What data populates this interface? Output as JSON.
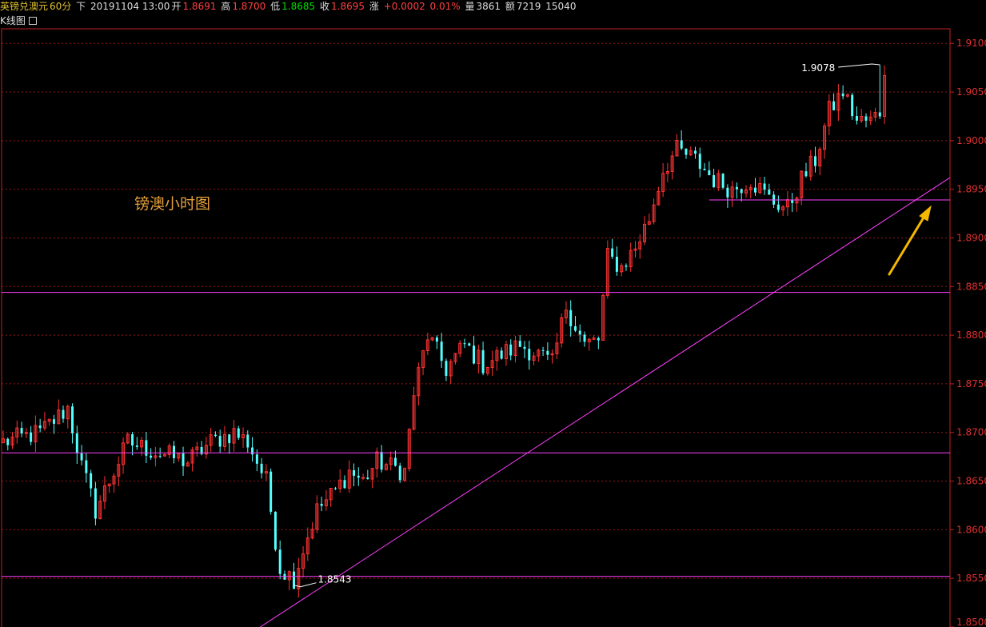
{
  "header": {
    "symbol": "英镑兑澳元",
    "period": "60分",
    "sub_label": "下",
    "datetime": "20191104 13:00",
    "open_label": "开",
    "open": "1.8691",
    "high_label": "高",
    "high": "1.8700",
    "low_label": "低",
    "low": "1.8685",
    "close_label": "收",
    "close": "1.8695",
    "change_label": "涨",
    "change": "+0.0002",
    "change_pct": "0.01%",
    "volume_label": "量",
    "volume": "3861",
    "amount_label": "额",
    "amount": "7219",
    "extra": "15040"
  },
  "panel": {
    "title": "K线图"
  },
  "annotation_text": "镑澳小时图",
  "colors": {
    "up": "#ff3232",
    "down": "#54ffff",
    "grid": "#8a1a1a",
    "axis": "#c02020",
    "hline": "#ff40ff",
    "arrow": "#f5b800"
  },
  "chart_data": {
    "type": "candlestick",
    "ylim": [
      1.85,
      1.9115
    ],
    "y_ticks": [
      "1.9100",
      "1.9050",
      "1.9000",
      "1.8950",
      "1.8900",
      "1.8850",
      "1.8800",
      "1.8750",
      "1.8700",
      "1.8650",
      "1.8600",
      "1.8550",
      "1.8500"
    ],
    "anchors": [
      [
        0,
        1.869
      ],
      [
        8,
        1.87
      ],
      [
        14,
        1.8725
      ],
      [
        17,
        1.8665
      ],
      [
        20,
        1.862
      ],
      [
        23,
        1.865
      ],
      [
        27,
        1.869
      ],
      [
        33,
        1.868
      ],
      [
        40,
        1.867
      ],
      [
        45,
        1.869
      ],
      [
        50,
        1.87
      ],
      [
        53,
        1.869
      ],
      [
        57,
        1.865
      ],
      [
        60,
        1.856
      ],
      [
        63,
        1.855
      ],
      [
        65,
        1.858
      ],
      [
        68,
        1.862
      ],
      [
        72,
        1.864
      ],
      [
        75,
        1.866
      ],
      [
        78,
        1.865
      ],
      [
        81,
        1.867
      ],
      [
        84,
        1.8665
      ],
      [
        87,
        1.866
      ],
      [
        89,
        1.874
      ],
      [
        92,
        1.88
      ],
      [
        96,
        1.8765
      ],
      [
        100,
        1.879
      ],
      [
        104,
        1.877
      ],
      [
        108,
        1.878
      ],
      [
        112,
        1.879
      ],
      [
        116,
        1.878
      ],
      [
        119,
        1.877
      ],
      [
        122,
        1.883
      ],
      [
        126,
        1.879
      ],
      [
        129,
        1.8795
      ],
      [
        131,
        1.888
      ],
      [
        134,
        1.887
      ],
      [
        137,
        1.889
      ],
      [
        140,
        1.892
      ],
      [
        143,
        1.897
      ],
      [
        146,
        1.899
      ],
      [
        150,
        1.898
      ],
      [
        154,
        1.896
      ],
      [
        158,
        1.895
      ],
      [
        162,
        1.896
      ],
      [
        166,
        1.894
      ],
      [
        170,
        1.893
      ],
      [
        173,
        1.896
      ],
      [
        176,
        1.898
      ],
      [
        179,
        1.903
      ],
      [
        182,
        1.905
      ],
      [
        185,
        1.902
      ],
      [
        188,
        1.902
      ],
      [
        190,
        1.903
      ],
      [
        191,
        1.9075
      ]
    ],
    "annotations": [
      {
        "text": "1.9078",
        "type": "high",
        "index": 190,
        "value": 1.9078
      },
      {
        "text": "1.8543",
        "type": "low",
        "index": 63,
        "value": 1.8543
      }
    ],
    "horizontal_lines": [
      1.8844,
      1.8679,
      1.8552
    ],
    "short_line": {
      "from_index": 153,
      "to_index": 191,
      "value": 1.8939
    },
    "trendline": {
      "from": [
        46,
        1.847
      ],
      "to": [
        191,
        1.8962
      ]
    }
  }
}
